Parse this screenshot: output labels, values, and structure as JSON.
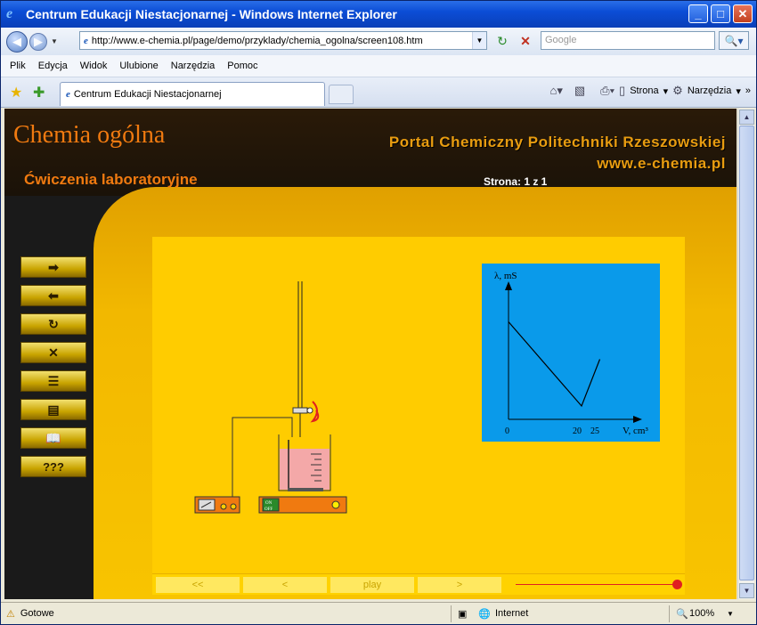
{
  "window": {
    "title": "Centrum Edukacji Niestacjonarnej - Windows Internet Explorer",
    "icon": "ie-icon"
  },
  "address": {
    "url": "http://www.e-chemia.pl/page/demo/przyklady/chemia_ogolna/screen108.htm",
    "search_placeholder": "Google"
  },
  "menu": [
    "Plik",
    "Edycja",
    "Widok",
    "Ulubione",
    "Narzędzia",
    "Pomoc"
  ],
  "tab": {
    "label": "Centrum Edukacji Niestacjonarnej"
  },
  "toolbar": {
    "strona": "Strona",
    "narzedzia": "Narzędzia"
  },
  "page": {
    "title": "Chemia ogólna",
    "subtitle": "Ćwiczenia laboratoryjne",
    "portal": "Portal Chemiczny Politechniki Rzeszowskiej",
    "url": "www.e-chemia.pl",
    "page_number": "Strona: 1 z 1"
  },
  "side_buttons": [
    {
      "icon": "arrow-right-icon",
      "label": "➡"
    },
    {
      "icon": "arrow-left-icon",
      "label": "⬅"
    },
    {
      "icon": "refresh-icon",
      "label": "↻"
    },
    {
      "icon": "close-icon",
      "label": "✕"
    },
    {
      "icon": "menu-icon",
      "label": "☰"
    },
    {
      "icon": "list-icon",
      "label": "▤"
    },
    {
      "icon": "book-icon",
      "label": "📖"
    },
    {
      "icon": "help-button",
      "label": "???"
    }
  ],
  "controls": {
    "first": "<<",
    "prev": "<",
    "play": "play",
    "next": ">"
  },
  "graph": {
    "ylabel": "λ, mS",
    "xlabel": "V, cm³",
    "ticks": [
      "0",
      "20",
      "25"
    ]
  },
  "chart_data": {
    "type": "line",
    "xlabel": "V, cm³",
    "ylabel": "λ, mS",
    "x": [
      0,
      20,
      25
    ],
    "series": [
      {
        "values": [
          0.73,
          0.1,
          0.45
        ]
      }
    ]
  },
  "status": {
    "text": "Gotowe",
    "zone": "Internet",
    "zoom": "100%"
  },
  "device": {
    "on_label": "ON",
    "off_label": "OFF"
  }
}
